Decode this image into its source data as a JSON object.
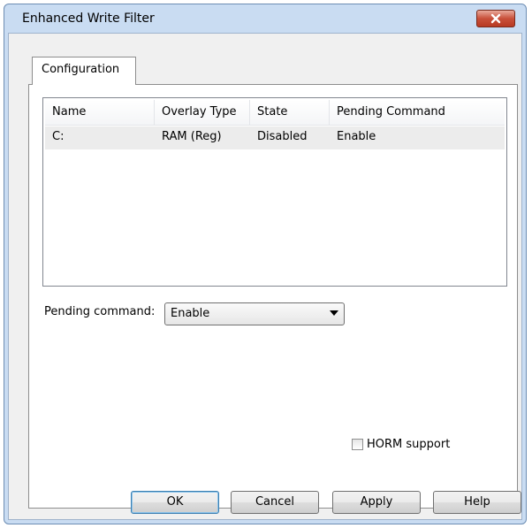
{
  "window": {
    "title": "Enhanced Write Filter"
  },
  "tabs": [
    {
      "label": "Configuration"
    }
  ],
  "table": {
    "columns": [
      "Name",
      "Overlay Type",
      "State",
      "Pending Command"
    ],
    "rows": [
      [
        "C:",
        "RAM (Reg)",
        "Disabled",
        "Enable"
      ]
    ]
  },
  "pending_command": {
    "label": "Pending command:",
    "value": "Enable"
  },
  "horm": {
    "label": "HORM support",
    "checked": false
  },
  "buttons": {
    "ok": "OK",
    "cancel": "Cancel",
    "apply": "Apply",
    "help": "Help"
  },
  "colors": {
    "close_button": "#c8503a",
    "frame": "#c9dcf2",
    "selected_row": "#ececec"
  },
  "icons": [
    "close-icon",
    "dropdown-arrow-icon"
  ]
}
